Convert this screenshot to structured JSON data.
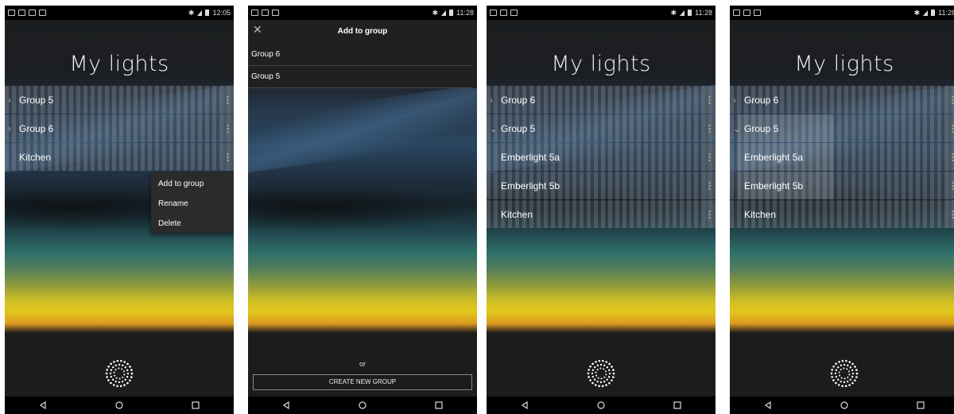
{
  "screens": [
    {
      "status_time": "12:05",
      "title": "My lights",
      "rows": [
        {
          "label": "Group 5",
          "kind": "group-collapsed"
        },
        {
          "label": "Group 6",
          "kind": "group-collapsed"
        },
        {
          "label": "Kitchen",
          "kind": "light"
        }
      ],
      "menu": [
        "Add to group",
        "Rename",
        "Delete"
      ]
    },
    {
      "status_time": "11:28",
      "title": "Add to group",
      "groups": [
        "Group 6",
        "Group 5"
      ],
      "or_text": "or",
      "create_button": "CREATE NEW GROUP"
    },
    {
      "status_time": "11:28",
      "title": "My lights",
      "rows": [
        {
          "label": "Group 6",
          "kind": "group-collapsed"
        },
        {
          "label": "Group 5",
          "kind": "group-expanded"
        },
        {
          "label": "Emberlight 5a",
          "kind": "child"
        },
        {
          "label": "Emberlight 5b",
          "kind": "child"
        },
        {
          "label": "Kitchen",
          "kind": "light"
        }
      ]
    },
    {
      "status_time": "11:28",
      "title": "My lights",
      "rows": [
        {
          "label": "Group 6",
          "kind": "group-collapsed",
          "level": 0
        },
        {
          "label": "Group 5",
          "kind": "group-expanded",
          "level": 0.5
        },
        {
          "label": "Emberlight 5a",
          "kind": "child",
          "level": 0.5
        },
        {
          "label": "Emberlight 5b",
          "kind": "child",
          "level": 0.5
        },
        {
          "label": "Kitchen",
          "kind": "light",
          "level": 0
        }
      ]
    }
  ],
  "icons": {
    "close": "close-icon",
    "chevron": "chevron-icon",
    "menu": "more-vert-icon",
    "logo": "emberlight-logo-icon"
  }
}
